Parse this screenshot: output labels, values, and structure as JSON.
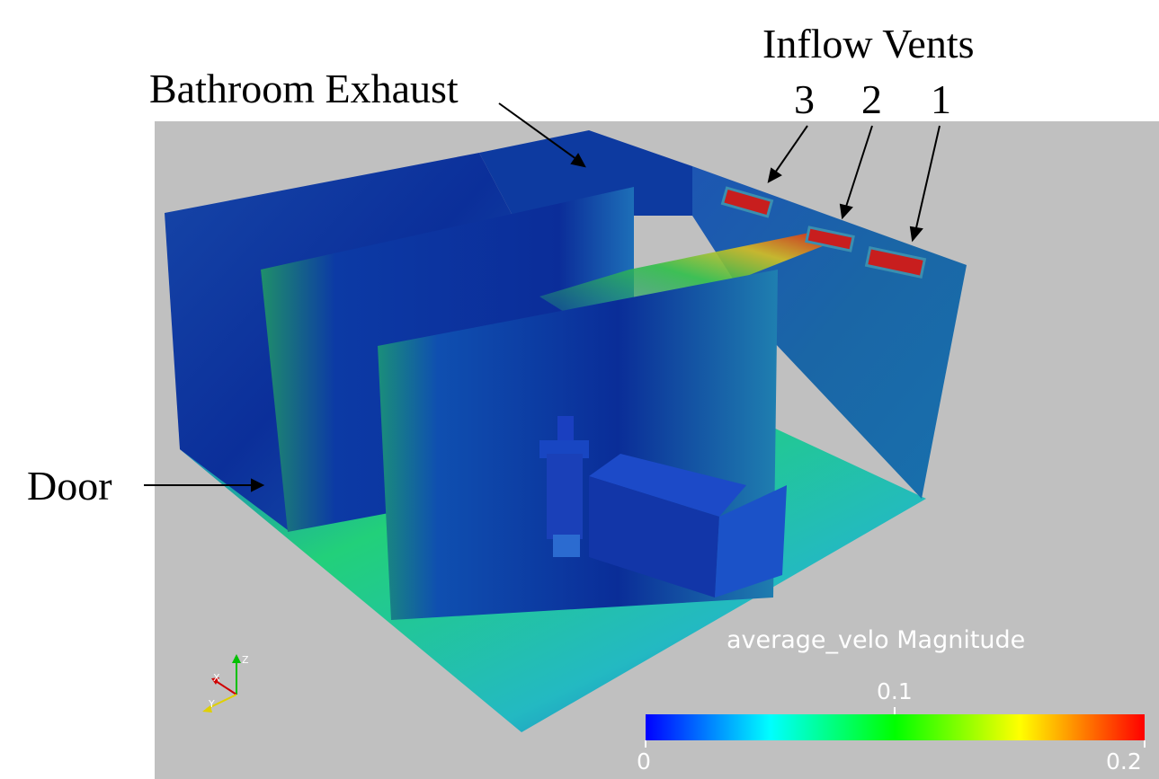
{
  "annotations": {
    "inflow_vents": "Inflow Vents",
    "vent_numbers": [
      "3",
      "2",
      "1"
    ],
    "bathroom_exhaust": "Bathroom Exhaust",
    "door": "Door"
  },
  "legend": {
    "title": "average_velo Magnitude",
    "min_label": "0",
    "mid_label": "0.1",
    "max_label": "0.2",
    "colors": [
      "#0000ff",
      "#00ffff",
      "#00ff00",
      "#ffff00",
      "#ff0000"
    ]
  },
  "orientation_axes": {
    "x": "X",
    "y": "Y",
    "z": "Z"
  },
  "colors": {
    "background_viewport": "#c0c0c0",
    "deep_blue": "#0a2a9a",
    "green": "#1fb15a",
    "cyan_floor": "#17c8b8",
    "vent_red": "#c81e1e"
  }
}
